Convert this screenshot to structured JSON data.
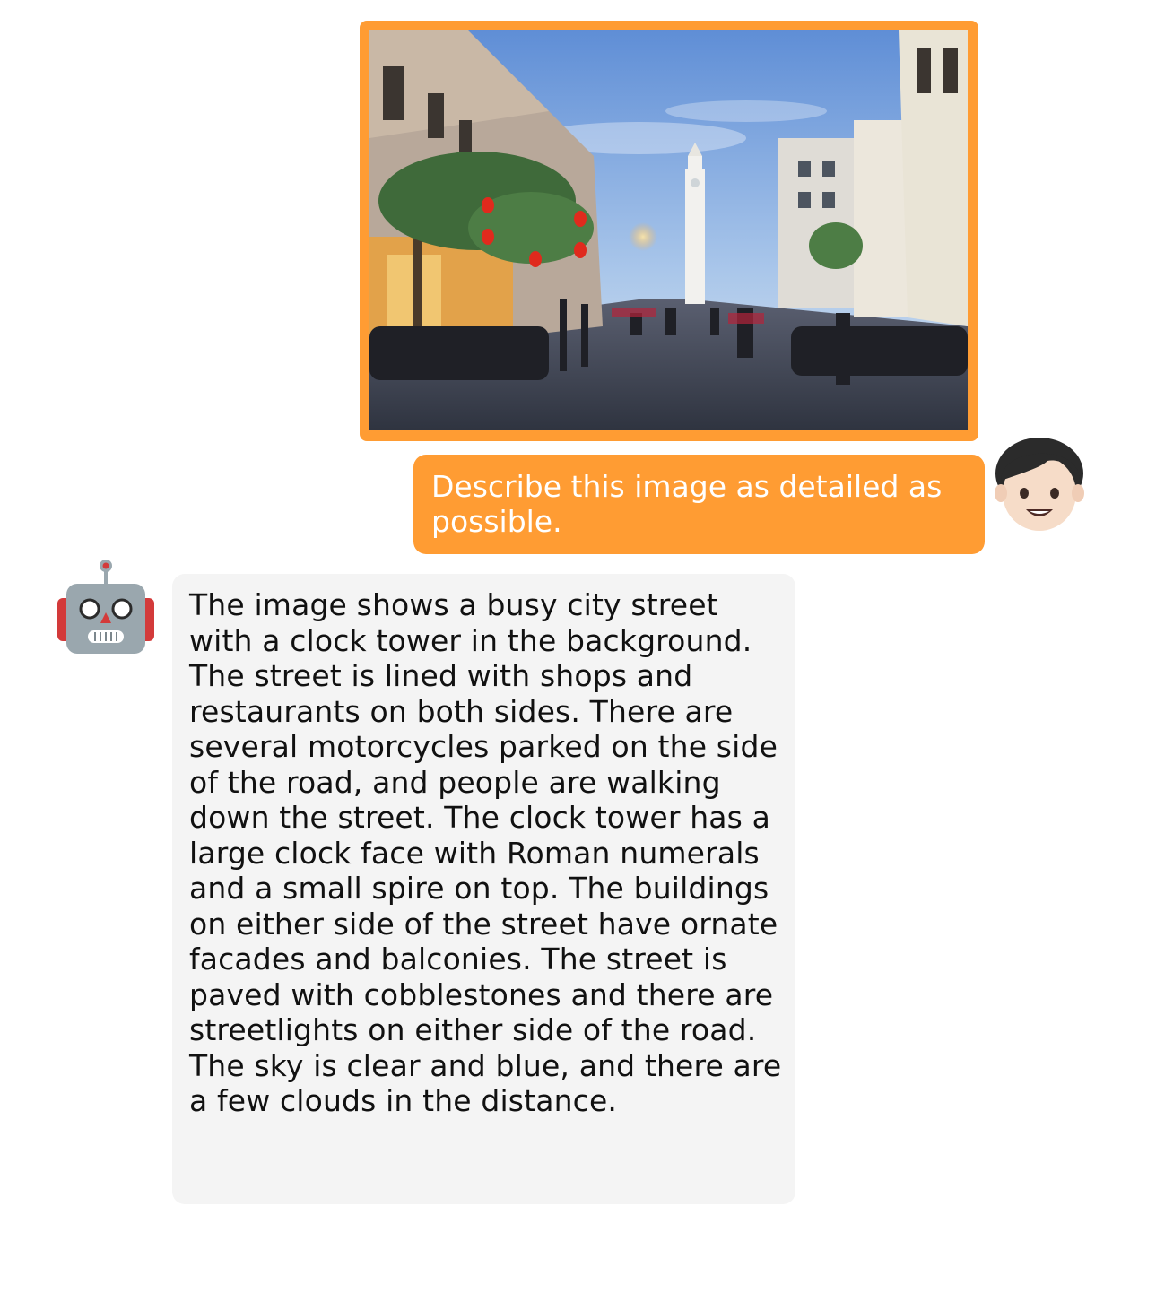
{
  "conversation": {
    "user": {
      "image_alt": "",
      "message": "Describe this image as detailed as possible.",
      "avatar_icon": "boy-face-icon"
    },
    "assistant": {
      "avatar_icon": "robot-face-icon",
      "message": "The image shows a busy city street with a clock tower in the background. The street is lined with shops and restaurants on both sides. There are several motorcycles parked on the side of the road, and people are walking down the street. The clock tower has a large clock face with Roman numerals and a small spire on top. The buildings on either side of the street have ornate facades and balconies. The street is paved with cobblestones and there are streetlights on either side of the road. The sky is clear and blue, and there are a few clouds in the distance."
    }
  },
  "colors": {
    "user_accent": "#FF9C33",
    "assistant_bubble": "#F4F4F4",
    "user_text": "#FFFFFF",
    "assistant_text": "#111111"
  }
}
